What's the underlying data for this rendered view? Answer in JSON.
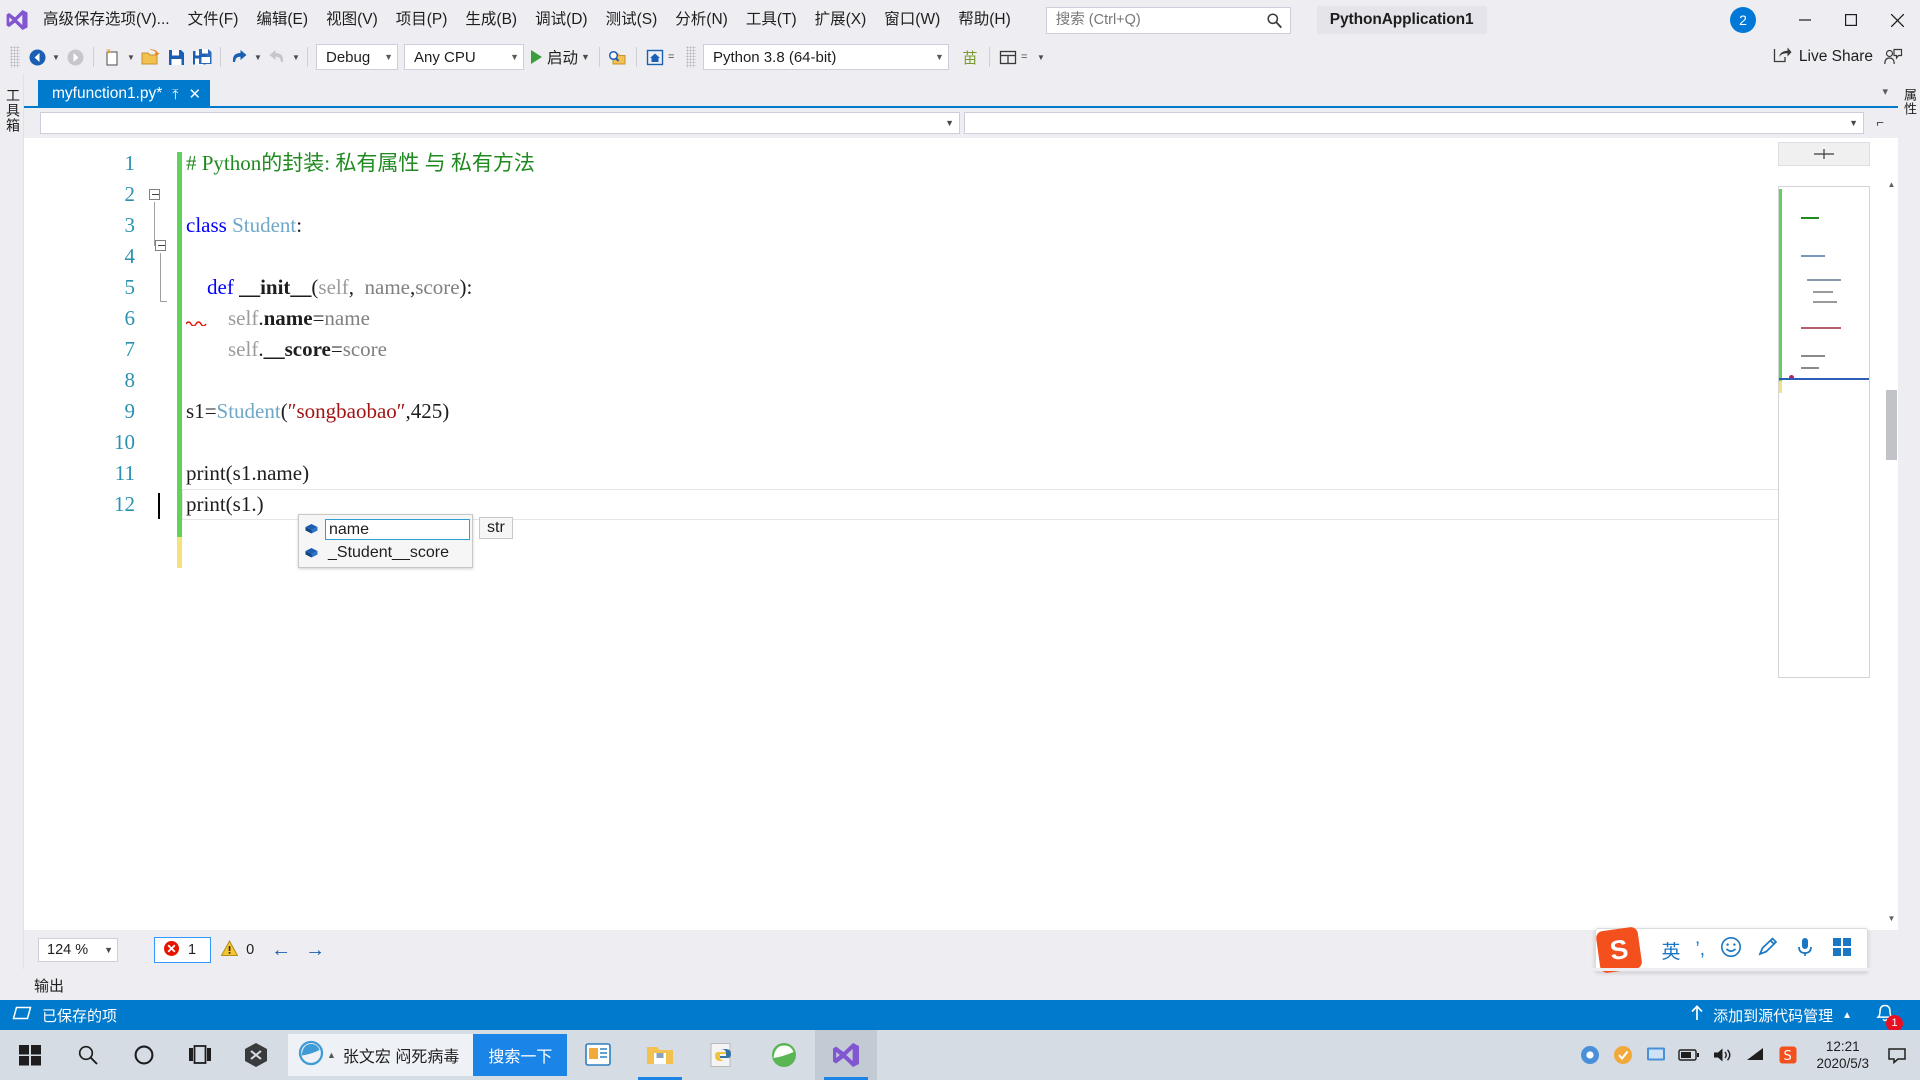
{
  "window": {
    "project_name": "PythonApplication1",
    "account_initial": "2",
    "minimize": "─",
    "maximize": "☐",
    "close": "✕"
  },
  "menu": {
    "items": [
      "高级保存选项(V)...",
      "文件(F)",
      "编辑(E)",
      "视图(V)",
      "项目(P)",
      "生成(B)",
      "调试(D)",
      "测试(S)",
      "分析(N)",
      "工具(T)",
      "扩展(X)",
      "窗口(W)",
      "帮助(H)"
    ]
  },
  "search": {
    "placeholder": "搜索 (Ctrl+Q)",
    "value": ""
  },
  "toolbar": {
    "config": "Debug",
    "platform": "Any CPU",
    "start_label": "启动",
    "interpreter": "Python 3.8 (64-bit)",
    "live_share": "Live Share",
    "caret": "▾"
  },
  "docks": {
    "left_label": "工具箱",
    "right_label": "属性"
  },
  "tab": {
    "title": "myfunction1.py*",
    "pin": "⤒",
    "close": "✕"
  },
  "editor": {
    "line_numbers": [
      "1",
      "2",
      "3",
      "4",
      "5",
      "6",
      "7",
      "8",
      "9",
      "10",
      "11",
      "12"
    ],
    "lines": [
      {
        "n": 1,
        "tokens": [
          {
            "t": "# Python的封装: 私有属性 与 私有方法",
            "c": "cmt"
          }
        ]
      },
      {
        "n": 2,
        "tokens": []
      },
      {
        "n": 3,
        "tokens": [
          {
            "t": "class ",
            "c": "kw"
          },
          {
            "t": "Student",
            "c": "cls"
          },
          {
            "t": ":",
            "c": "pl"
          }
        ]
      },
      {
        "n": 4,
        "tokens": []
      },
      {
        "n": 5,
        "tokens": [
          {
            "t": "    ",
            "c": "pl"
          },
          {
            "t": "def ",
            "c": "kw"
          },
          {
            "t": "__init__",
            "c": "pl bold"
          },
          {
            "t": "(",
            "c": "pl"
          },
          {
            "t": "self",
            "c": "self"
          },
          {
            "t": ",  ",
            "c": "pl"
          },
          {
            "t": "name",
            "c": "param"
          },
          {
            "t": ",",
            "c": "pl"
          },
          {
            "t": "score",
            "c": "param"
          },
          {
            "t": "):",
            "c": "pl"
          }
        ]
      },
      {
        "n": 6,
        "tokens": [
          {
            "t": "        ",
            "c": "pl"
          },
          {
            "t": "self",
            "c": "self"
          },
          {
            "t": ".",
            "c": "pl"
          },
          {
            "t": "name",
            "c": "pl bold"
          },
          {
            "t": "=",
            "c": "pl"
          },
          {
            "t": "name",
            "c": "param"
          }
        ]
      },
      {
        "n": 7,
        "tokens": [
          {
            "t": "        ",
            "c": "pl"
          },
          {
            "t": "self",
            "c": "self"
          },
          {
            "t": ".",
            "c": "pl"
          },
          {
            "t": "__score",
            "c": "pl bold"
          },
          {
            "t": "=",
            "c": "pl"
          },
          {
            "t": "score",
            "c": "param"
          }
        ]
      },
      {
        "n": 8,
        "tokens": []
      },
      {
        "n": 9,
        "tokens": [
          {
            "t": "s1",
            "c": "pl"
          },
          {
            "t": "=",
            "c": "pl"
          },
          {
            "t": "Student",
            "c": "cls"
          },
          {
            "t": "(",
            "c": "pl"
          },
          {
            "t": "″songbaobao″",
            "c": "str"
          },
          {
            "t": ",",
            "c": "pl"
          },
          {
            "t": "425",
            "c": "num"
          },
          {
            "t": ")",
            "c": "pl"
          }
        ]
      },
      {
        "n": 10,
        "tokens": []
      },
      {
        "n": 11,
        "tokens": [
          {
            "t": "print",
            "c": "pl"
          },
          {
            "t": "(",
            "c": "pl"
          },
          {
            "t": "s1",
            "c": "pl"
          },
          {
            "t": ".",
            "c": "pl"
          },
          {
            "t": "name",
            "c": "pl"
          },
          {
            "t": ")",
            "c": "pl"
          }
        ]
      },
      {
        "n": 12,
        "tokens": [
          {
            "t": "print",
            "c": "pl"
          },
          {
            "t": "(",
            "c": "pl"
          },
          {
            "t": "s1",
            "c": "pl"
          },
          {
            "t": ".",
            "c": "pl"
          },
          {
            "t": ")",
            "c": "pl"
          }
        ]
      }
    ]
  },
  "intellisense": {
    "items": [
      {
        "label": "name",
        "selected": true
      },
      {
        "label": "_Student__score",
        "selected": false
      }
    ],
    "tooltip": "str"
  },
  "status": {
    "zoom": "124 %",
    "error_count": "1",
    "warning_count": "0",
    "nav_back": "←",
    "nav_forward": "→",
    "output_label": "输出",
    "saved_item": "已保存的项",
    "source_control": "添加到源代码管理",
    "notification_count": "1"
  },
  "ime": {
    "mode": "英",
    "punct": "’,"
  },
  "taskbar": {
    "news_text": "张文宏 闷死病毒",
    "news_button": "搜索一下",
    "time": "12:21",
    "date": "2020/5/3"
  }
}
